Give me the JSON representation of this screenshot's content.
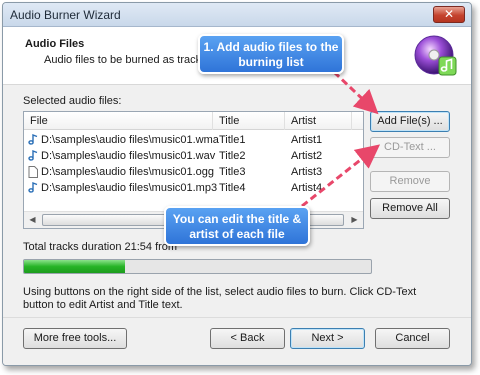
{
  "window": {
    "title": "Audio Burner Wizard",
    "close_label": "✕"
  },
  "header": {
    "title": "Audio Files",
    "subtitle": "Audio files to be burned as tracks on",
    "icon": "audio-disc-icon"
  },
  "list": {
    "label": "Selected audio files:",
    "columns": [
      "File",
      "Title",
      "Artist"
    ],
    "rows": [
      {
        "file": "D:\\samples\\audio files\\music01.wma",
        "title": "Title1",
        "artist": "Artist1",
        "icon": "music-note-icon"
      },
      {
        "file": "D:\\samples\\audio files\\music01.wav",
        "title": "Title2",
        "artist": "Artist2",
        "icon": "music-note-icon"
      },
      {
        "file": "D:\\samples\\audio files\\music01.ogg",
        "title": "Title3",
        "artist": "Artist3",
        "icon": "blank-file-icon"
      },
      {
        "file": "D:\\samples\\audio files\\music01.mp3",
        "title": "Title4",
        "artist": "Artist4",
        "icon": "music-note-icon"
      }
    ]
  },
  "buttons": {
    "add_files": "Add File(s) ...",
    "cd_text": "CD-Text ...",
    "remove": "Remove",
    "remove_all": "Remove All",
    "more_tools": "More free tools...",
    "back": "< Back",
    "next": "Next >",
    "cancel": "Cancel"
  },
  "status": {
    "duration": "Total tracks duration 21:54 from",
    "progress": 0.29,
    "progress_color": "#27b427"
  },
  "help_text": "Using buttons on the right side of the list, select audio files to burn. Click CD-Text button to edit Artist and Title text.",
  "callouts": {
    "add_files": "1. Add audio files to the burning list",
    "edit": "You can edit the title & artist of each file",
    "arrow_color": "#e8476a"
  }
}
